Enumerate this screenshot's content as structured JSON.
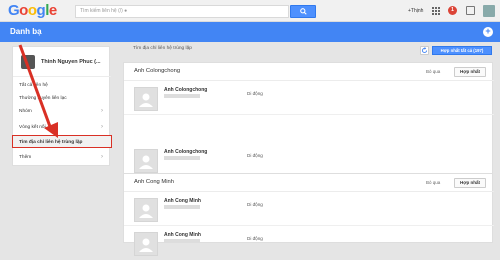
{
  "topbar": {
    "logo_letters": [
      "G",
      "o",
      "o",
      "g",
      "l",
      "e"
    ],
    "logo_colors": [
      "#4285f4",
      "#ea4335",
      "#fbbc05",
      "#4285f4",
      "#34a853",
      "#ea4335"
    ],
    "search_placeholder": "Tìm kiếm liên hệ (/) ●",
    "user_name": "+Thịnh",
    "notification_count": "1"
  },
  "header": {
    "title": "Danh bạ",
    "add_label": "+"
  },
  "sidebar": {
    "user_name": "Thinh Nguyen Phuc (...",
    "items": [
      {
        "label": "Tất cả liên hệ",
        "chevron": ""
      },
      {
        "label": "Thường xuyên liên lạc",
        "chevron": ""
      },
      {
        "label": "Nhóm",
        "chevron": "›"
      },
      {
        "label": "Vòng kết nối",
        "chevron": "›"
      },
      {
        "label": "Tìm địa chỉ liên hệ trùng lặp",
        "chevron": ""
      },
      {
        "label": "Thêm",
        "chevron": "›"
      }
    ]
  },
  "main": {
    "heading": "Tìm địa chỉ liên hệ trùng lặp",
    "merge_all_label": "Hợp nhất tất cả (197)",
    "groups": [
      {
        "name": "Anh Colongchong",
        "skip_label": "Bỏ qua",
        "merge_label": "Hợp nhất",
        "rows": [
          {
            "name": "Anh Colongchong",
            "phone": "Di động"
          },
          {
            "name": "Anh Colongchong",
            "phone": "Di động"
          }
        ]
      },
      {
        "name": "Anh Cong Minh",
        "skip_label": "Bỏ qua",
        "merge_label": "Hợp nhất",
        "rows": [
          {
            "name": "Anh Cong Minh",
            "phone": "Di động"
          },
          {
            "name": "Anh Cong Minh",
            "phone": "Di động"
          }
        ]
      }
    ]
  },
  "colors": {
    "accent_blue": "#4285f4",
    "highlight_red": "#d93025"
  }
}
